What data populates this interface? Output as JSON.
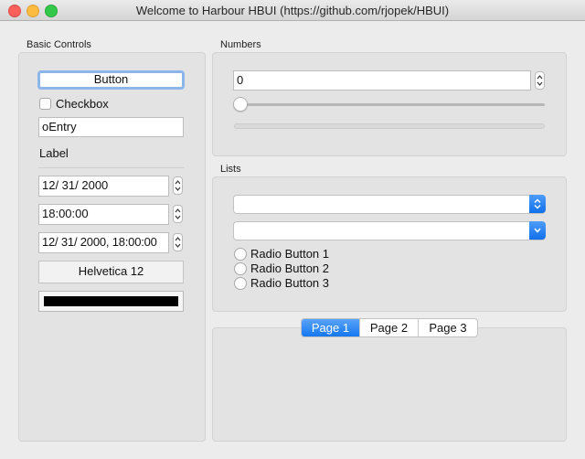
{
  "window": {
    "title": "Welcome to Harbour HBUI (https://github.com/rjopek/HBUI)"
  },
  "basic_controls": {
    "title": "Basic Controls",
    "button_label": "Button",
    "checkbox_label": "Checkbox",
    "entry_value": "oEntry",
    "label_text": "Label",
    "date_value": "12/ 31/ 2000",
    "time_value": "18:00:00",
    "datetime_value": "12/ 31/ 2000,  18:00:00",
    "font_button_label": "Helvetica 12",
    "color_value": "#000000"
  },
  "numbers": {
    "title": "Numbers",
    "spinbox_value": "0",
    "slider_value": 0,
    "progress_value": 0
  },
  "lists": {
    "title": "Lists",
    "combo1_value": "",
    "combo2_value": "",
    "radio_options": [
      "Radio Button 1",
      "Radio Button 2",
      "Radio Button 3"
    ]
  },
  "tabs": {
    "items": [
      "Page 1",
      "Page 2",
      "Page 3"
    ],
    "active_index": 0
  },
  "colors": {
    "accent": "#1577ef"
  }
}
